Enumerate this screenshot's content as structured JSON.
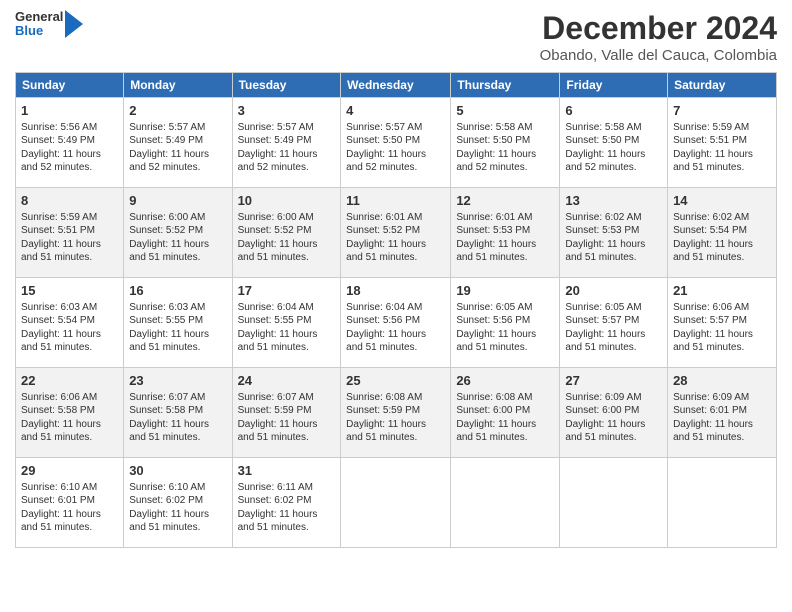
{
  "header": {
    "logo": {
      "general": "General",
      "blue": "Blue"
    },
    "title": "December 2024",
    "subtitle": "Obando, Valle del Cauca, Colombia"
  },
  "days_of_week": [
    "Sunday",
    "Monday",
    "Tuesday",
    "Wednesday",
    "Thursday",
    "Friday",
    "Saturday"
  ],
  "weeks": [
    [
      {
        "day": "1",
        "info": "Sunrise: 5:56 AM\nSunset: 5:49 PM\nDaylight: 11 hours\nand 52 minutes."
      },
      {
        "day": "2",
        "info": "Sunrise: 5:57 AM\nSunset: 5:49 PM\nDaylight: 11 hours\nand 52 minutes."
      },
      {
        "day": "3",
        "info": "Sunrise: 5:57 AM\nSunset: 5:49 PM\nDaylight: 11 hours\nand 52 minutes."
      },
      {
        "day": "4",
        "info": "Sunrise: 5:57 AM\nSunset: 5:50 PM\nDaylight: 11 hours\nand 52 minutes."
      },
      {
        "day": "5",
        "info": "Sunrise: 5:58 AM\nSunset: 5:50 PM\nDaylight: 11 hours\nand 52 minutes."
      },
      {
        "day": "6",
        "info": "Sunrise: 5:58 AM\nSunset: 5:50 PM\nDaylight: 11 hours\nand 52 minutes."
      },
      {
        "day": "7",
        "info": "Sunrise: 5:59 AM\nSunset: 5:51 PM\nDaylight: 11 hours\nand 51 minutes."
      }
    ],
    [
      {
        "day": "8",
        "info": "Sunrise: 5:59 AM\nSunset: 5:51 PM\nDaylight: 11 hours\nand 51 minutes."
      },
      {
        "day": "9",
        "info": "Sunrise: 6:00 AM\nSunset: 5:52 PM\nDaylight: 11 hours\nand 51 minutes."
      },
      {
        "day": "10",
        "info": "Sunrise: 6:00 AM\nSunset: 5:52 PM\nDaylight: 11 hours\nand 51 minutes."
      },
      {
        "day": "11",
        "info": "Sunrise: 6:01 AM\nSunset: 5:52 PM\nDaylight: 11 hours\nand 51 minutes."
      },
      {
        "day": "12",
        "info": "Sunrise: 6:01 AM\nSunset: 5:53 PM\nDaylight: 11 hours\nand 51 minutes."
      },
      {
        "day": "13",
        "info": "Sunrise: 6:02 AM\nSunset: 5:53 PM\nDaylight: 11 hours\nand 51 minutes."
      },
      {
        "day": "14",
        "info": "Sunrise: 6:02 AM\nSunset: 5:54 PM\nDaylight: 11 hours\nand 51 minutes."
      }
    ],
    [
      {
        "day": "15",
        "info": "Sunrise: 6:03 AM\nSunset: 5:54 PM\nDaylight: 11 hours\nand 51 minutes."
      },
      {
        "day": "16",
        "info": "Sunrise: 6:03 AM\nSunset: 5:55 PM\nDaylight: 11 hours\nand 51 minutes."
      },
      {
        "day": "17",
        "info": "Sunrise: 6:04 AM\nSunset: 5:55 PM\nDaylight: 11 hours\nand 51 minutes."
      },
      {
        "day": "18",
        "info": "Sunrise: 6:04 AM\nSunset: 5:56 PM\nDaylight: 11 hours\nand 51 minutes."
      },
      {
        "day": "19",
        "info": "Sunrise: 6:05 AM\nSunset: 5:56 PM\nDaylight: 11 hours\nand 51 minutes."
      },
      {
        "day": "20",
        "info": "Sunrise: 6:05 AM\nSunset: 5:57 PM\nDaylight: 11 hours\nand 51 minutes."
      },
      {
        "day": "21",
        "info": "Sunrise: 6:06 AM\nSunset: 5:57 PM\nDaylight: 11 hours\nand 51 minutes."
      }
    ],
    [
      {
        "day": "22",
        "info": "Sunrise: 6:06 AM\nSunset: 5:58 PM\nDaylight: 11 hours\nand 51 minutes."
      },
      {
        "day": "23",
        "info": "Sunrise: 6:07 AM\nSunset: 5:58 PM\nDaylight: 11 hours\nand 51 minutes."
      },
      {
        "day": "24",
        "info": "Sunrise: 6:07 AM\nSunset: 5:59 PM\nDaylight: 11 hours\nand 51 minutes."
      },
      {
        "day": "25",
        "info": "Sunrise: 6:08 AM\nSunset: 5:59 PM\nDaylight: 11 hours\nand 51 minutes."
      },
      {
        "day": "26",
        "info": "Sunrise: 6:08 AM\nSunset: 6:00 PM\nDaylight: 11 hours\nand 51 minutes."
      },
      {
        "day": "27",
        "info": "Sunrise: 6:09 AM\nSunset: 6:00 PM\nDaylight: 11 hours\nand 51 minutes."
      },
      {
        "day": "28",
        "info": "Sunrise: 6:09 AM\nSunset: 6:01 PM\nDaylight: 11 hours\nand 51 minutes."
      }
    ],
    [
      {
        "day": "29",
        "info": "Sunrise: 6:10 AM\nSunset: 6:01 PM\nDaylight: 11 hours\nand 51 minutes."
      },
      {
        "day": "30",
        "info": "Sunrise: 6:10 AM\nSunset: 6:02 PM\nDaylight: 11 hours\nand 51 minutes."
      },
      {
        "day": "31",
        "info": "Sunrise: 6:11 AM\nSunset: 6:02 PM\nDaylight: 11 hours\nand 51 minutes."
      },
      {
        "day": "",
        "info": ""
      },
      {
        "day": "",
        "info": ""
      },
      {
        "day": "",
        "info": ""
      },
      {
        "day": "",
        "info": ""
      }
    ]
  ]
}
